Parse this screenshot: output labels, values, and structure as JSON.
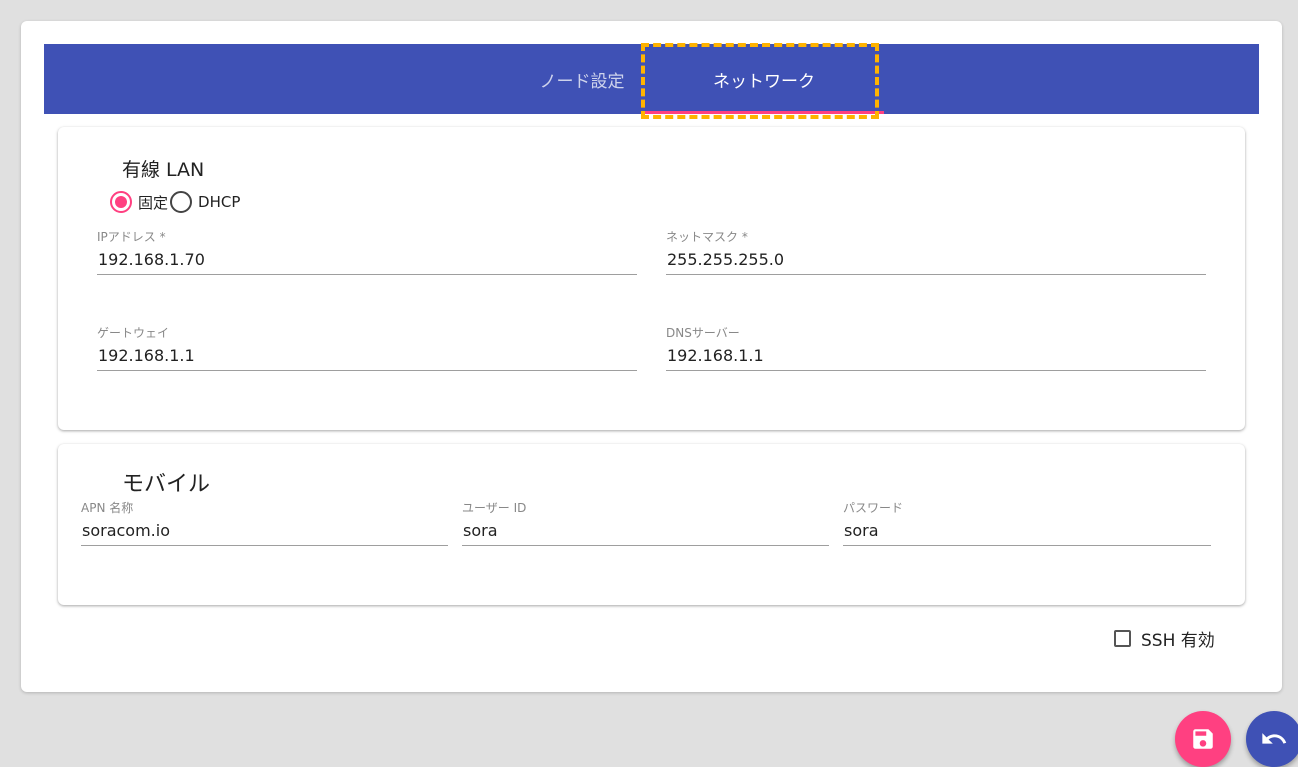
{
  "tabs": {
    "node_settings": "ノード設定",
    "network": "ネットワーク"
  },
  "wired": {
    "title": "有線 LAN",
    "mode_options": [
      "固定",
      "DHCP"
    ],
    "selected_mode": "固定",
    "ip_address": {
      "label": "IPアドレス *",
      "value": "192.168.1.70"
    },
    "netmask": {
      "label": "ネットマスク *",
      "value": "255.255.255.0"
    },
    "gateway": {
      "label": "ゲートウェイ",
      "value": "192.168.1.1"
    },
    "dns": {
      "label": "DNSサーバー",
      "value": "192.168.1.1"
    }
  },
  "mobile": {
    "title": "モバイル",
    "apn": {
      "label": "APN 名称",
      "value": "soracom.io"
    },
    "user_id": {
      "label": "ユーザー ID",
      "value": "sora"
    },
    "password": {
      "label": "パスワード",
      "value": "sora"
    }
  },
  "ssh": {
    "label": "SSH 有効",
    "checked": false
  },
  "colors": {
    "primary": "#3f51b5",
    "accent": "#ff4081",
    "highlight": "#ffb300"
  },
  "icons": {
    "save": "save-icon",
    "undo": "undo-icon"
  }
}
